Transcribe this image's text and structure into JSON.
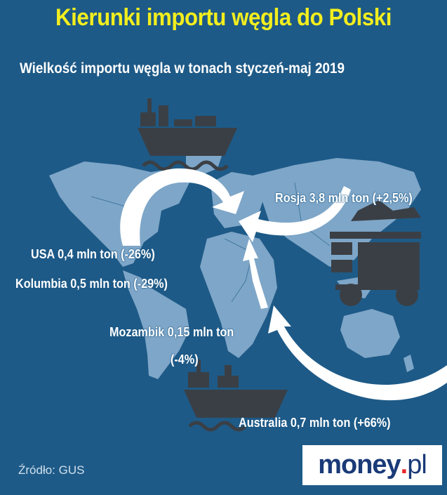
{
  "title": "Kierunki importu węgla do Polski",
  "subtitle": "Wielkość importu węgla w tonach styczeń-maj 2019",
  "labels": {
    "rosja": "Rosja 3,8 mln ton (+2,5%)",
    "usa": "USA 0,4 mln ton (-26%)",
    "kolumbia": "Kolumbia 0,5 mln ton (-29%)",
    "mozambik_line1": "Mozambik 0,15 mln ton",
    "mozambik_line2": "(-4%)",
    "australia": "Australia 0,7 mln ton (+66%)"
  },
  "source": "Źródło: GUS",
  "logo": {
    "brand": "money",
    "dot": ".",
    "tld": "pl"
  },
  "colors": {
    "background": "#1e5a87",
    "title": "#f2ee1e",
    "map_land": "#8fb4d4",
    "arrow": "#ffffff",
    "icon": "#3a3f45",
    "logo_text": "#1a3a78",
    "logo_dot": "#e8262a"
  },
  "icons": [
    "ship-icon-top",
    "ship-icon-bottom",
    "coal-cart-icon"
  ]
}
